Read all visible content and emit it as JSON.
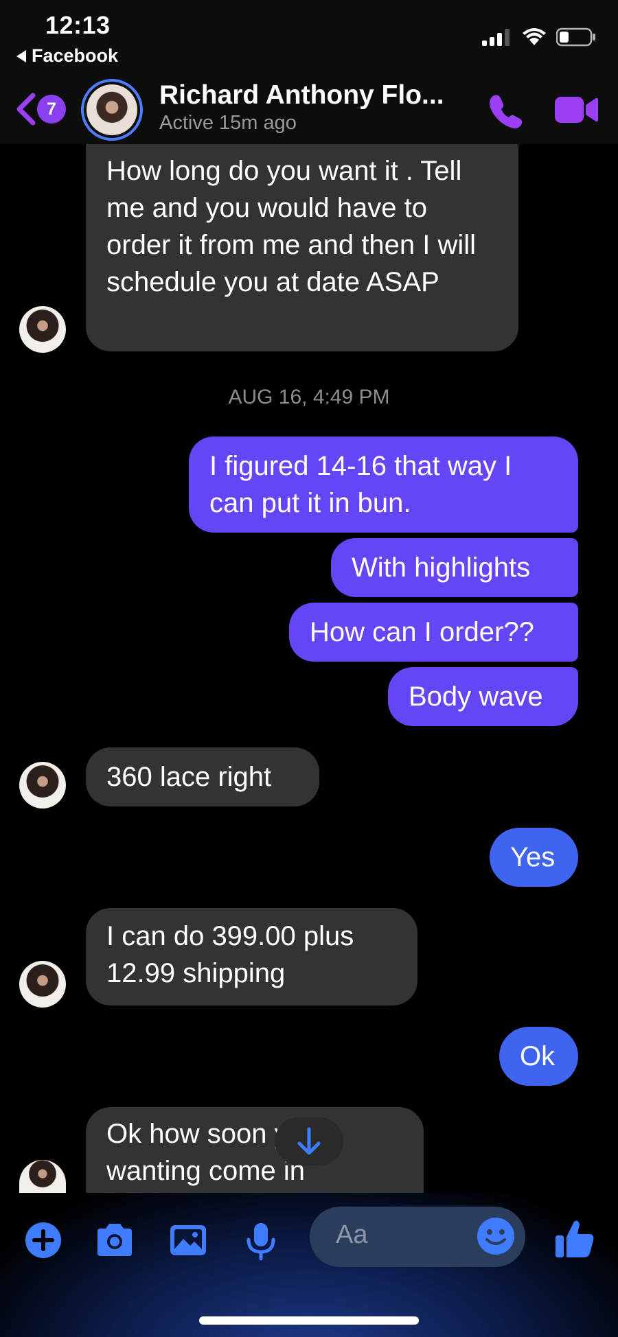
{
  "status_bar": {
    "time": "12:13",
    "back_app": "Facebook"
  },
  "header": {
    "unread_count": "7",
    "contact_name": "Richard Anthony Flo...",
    "active_status": "Active 15m ago"
  },
  "timestamp": "AUG 16, 4:49 PM",
  "messages": [
    {
      "from": "them",
      "text": "How long do you want it . Tell me and you would have to order it from me and then I will schedule you at date ASAP"
    },
    {
      "from": "me",
      "text": "I figured 14-16 that way I can put it in bun."
    },
    {
      "from": "me",
      "text": "With highlights"
    },
    {
      "from": "me",
      "text": "How can I order??"
    },
    {
      "from": "me",
      "text": "Body wave"
    },
    {
      "from": "them",
      "text": "360 lace right"
    },
    {
      "from": "me",
      "text": "Yes"
    },
    {
      "from": "them",
      "text": "I can do 399.00 plus 12.99 shipping"
    },
    {
      "from": "me",
      "text": "Ok"
    },
    {
      "from": "them",
      "text": "Ok how soon you wanting come in"
    }
  ],
  "composer": {
    "placeholder": "Aa"
  },
  "colors": {
    "outgoing_purple": "#6545f6",
    "outgoing_blue": "#3f65f0",
    "incoming": "#333333",
    "accent": "#9b3ff2",
    "icon_blue": "#3f7cff"
  },
  "icons": [
    "back-chevron-icon",
    "phone-icon",
    "video-camera-icon",
    "arrow-down-icon",
    "plus-icon",
    "camera-icon",
    "photo-icon",
    "microphone-icon",
    "emoji-icon",
    "thumbs-up-icon"
  ]
}
